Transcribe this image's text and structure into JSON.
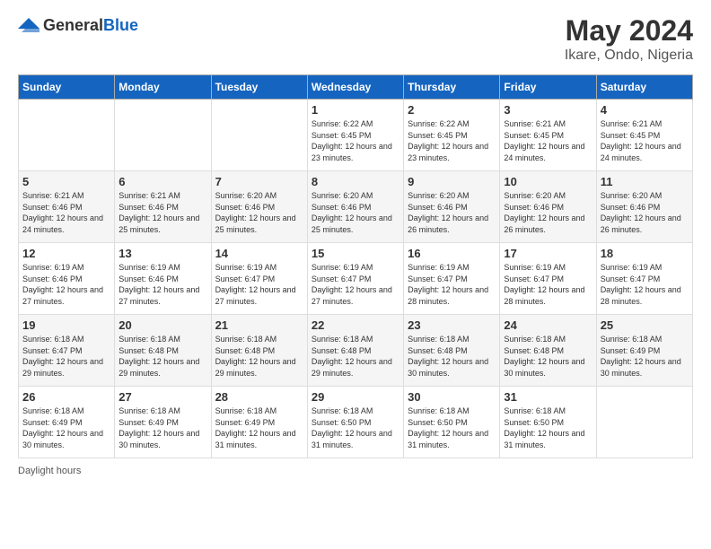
{
  "header": {
    "logo_general": "General",
    "logo_blue": "Blue",
    "main_title": "May 2024",
    "subtitle": "Ikare, Ondo, Nigeria"
  },
  "columns": [
    "Sunday",
    "Monday",
    "Tuesday",
    "Wednesday",
    "Thursday",
    "Friday",
    "Saturday"
  ],
  "footer": {
    "daylight_label": "Daylight hours"
  },
  "weeks": [
    [
      {
        "day": "",
        "sunrise": "",
        "sunset": "",
        "daylight": ""
      },
      {
        "day": "",
        "sunrise": "",
        "sunset": "",
        "daylight": ""
      },
      {
        "day": "",
        "sunrise": "",
        "sunset": "",
        "daylight": ""
      },
      {
        "day": "1",
        "sunrise": "Sunrise: 6:22 AM",
        "sunset": "Sunset: 6:45 PM",
        "daylight": "Daylight: 12 hours and 23 minutes."
      },
      {
        "day": "2",
        "sunrise": "Sunrise: 6:22 AM",
        "sunset": "Sunset: 6:45 PM",
        "daylight": "Daylight: 12 hours and 23 minutes."
      },
      {
        "day": "3",
        "sunrise": "Sunrise: 6:21 AM",
        "sunset": "Sunset: 6:45 PM",
        "daylight": "Daylight: 12 hours and 24 minutes."
      },
      {
        "day": "4",
        "sunrise": "Sunrise: 6:21 AM",
        "sunset": "Sunset: 6:45 PM",
        "daylight": "Daylight: 12 hours and 24 minutes."
      }
    ],
    [
      {
        "day": "5",
        "sunrise": "Sunrise: 6:21 AM",
        "sunset": "Sunset: 6:46 PM",
        "daylight": "Daylight: 12 hours and 24 minutes."
      },
      {
        "day": "6",
        "sunrise": "Sunrise: 6:21 AM",
        "sunset": "Sunset: 6:46 PM",
        "daylight": "Daylight: 12 hours and 25 minutes."
      },
      {
        "day": "7",
        "sunrise": "Sunrise: 6:20 AM",
        "sunset": "Sunset: 6:46 PM",
        "daylight": "Daylight: 12 hours and 25 minutes."
      },
      {
        "day": "8",
        "sunrise": "Sunrise: 6:20 AM",
        "sunset": "Sunset: 6:46 PM",
        "daylight": "Daylight: 12 hours and 25 minutes."
      },
      {
        "day": "9",
        "sunrise": "Sunrise: 6:20 AM",
        "sunset": "Sunset: 6:46 PM",
        "daylight": "Daylight: 12 hours and 26 minutes."
      },
      {
        "day": "10",
        "sunrise": "Sunrise: 6:20 AM",
        "sunset": "Sunset: 6:46 PM",
        "daylight": "Daylight: 12 hours and 26 minutes."
      },
      {
        "day": "11",
        "sunrise": "Sunrise: 6:20 AM",
        "sunset": "Sunset: 6:46 PM",
        "daylight": "Daylight: 12 hours and 26 minutes."
      }
    ],
    [
      {
        "day": "12",
        "sunrise": "Sunrise: 6:19 AM",
        "sunset": "Sunset: 6:46 PM",
        "daylight": "Daylight: 12 hours and 27 minutes."
      },
      {
        "day": "13",
        "sunrise": "Sunrise: 6:19 AM",
        "sunset": "Sunset: 6:46 PM",
        "daylight": "Daylight: 12 hours and 27 minutes."
      },
      {
        "day": "14",
        "sunrise": "Sunrise: 6:19 AM",
        "sunset": "Sunset: 6:47 PM",
        "daylight": "Daylight: 12 hours and 27 minutes."
      },
      {
        "day": "15",
        "sunrise": "Sunrise: 6:19 AM",
        "sunset": "Sunset: 6:47 PM",
        "daylight": "Daylight: 12 hours and 27 minutes."
      },
      {
        "day": "16",
        "sunrise": "Sunrise: 6:19 AM",
        "sunset": "Sunset: 6:47 PM",
        "daylight": "Daylight: 12 hours and 28 minutes."
      },
      {
        "day": "17",
        "sunrise": "Sunrise: 6:19 AM",
        "sunset": "Sunset: 6:47 PM",
        "daylight": "Daylight: 12 hours and 28 minutes."
      },
      {
        "day": "18",
        "sunrise": "Sunrise: 6:19 AM",
        "sunset": "Sunset: 6:47 PM",
        "daylight": "Daylight: 12 hours and 28 minutes."
      }
    ],
    [
      {
        "day": "19",
        "sunrise": "Sunrise: 6:18 AM",
        "sunset": "Sunset: 6:47 PM",
        "daylight": "Daylight: 12 hours and 29 minutes."
      },
      {
        "day": "20",
        "sunrise": "Sunrise: 6:18 AM",
        "sunset": "Sunset: 6:48 PM",
        "daylight": "Daylight: 12 hours and 29 minutes."
      },
      {
        "day": "21",
        "sunrise": "Sunrise: 6:18 AM",
        "sunset": "Sunset: 6:48 PM",
        "daylight": "Daylight: 12 hours and 29 minutes."
      },
      {
        "day": "22",
        "sunrise": "Sunrise: 6:18 AM",
        "sunset": "Sunset: 6:48 PM",
        "daylight": "Daylight: 12 hours and 29 minutes."
      },
      {
        "day": "23",
        "sunrise": "Sunrise: 6:18 AM",
        "sunset": "Sunset: 6:48 PM",
        "daylight": "Daylight: 12 hours and 30 minutes."
      },
      {
        "day": "24",
        "sunrise": "Sunrise: 6:18 AM",
        "sunset": "Sunset: 6:48 PM",
        "daylight": "Daylight: 12 hours and 30 minutes."
      },
      {
        "day": "25",
        "sunrise": "Sunrise: 6:18 AM",
        "sunset": "Sunset: 6:49 PM",
        "daylight": "Daylight: 12 hours and 30 minutes."
      }
    ],
    [
      {
        "day": "26",
        "sunrise": "Sunrise: 6:18 AM",
        "sunset": "Sunset: 6:49 PM",
        "daylight": "Daylight: 12 hours and 30 minutes."
      },
      {
        "day": "27",
        "sunrise": "Sunrise: 6:18 AM",
        "sunset": "Sunset: 6:49 PM",
        "daylight": "Daylight: 12 hours and 30 minutes."
      },
      {
        "day": "28",
        "sunrise": "Sunrise: 6:18 AM",
        "sunset": "Sunset: 6:49 PM",
        "daylight": "Daylight: 12 hours and 31 minutes."
      },
      {
        "day": "29",
        "sunrise": "Sunrise: 6:18 AM",
        "sunset": "Sunset: 6:50 PM",
        "daylight": "Daylight: 12 hours and 31 minutes."
      },
      {
        "day": "30",
        "sunrise": "Sunrise: 6:18 AM",
        "sunset": "Sunset: 6:50 PM",
        "daylight": "Daylight: 12 hours and 31 minutes."
      },
      {
        "day": "31",
        "sunrise": "Sunrise: 6:18 AM",
        "sunset": "Sunset: 6:50 PM",
        "daylight": "Daylight: 12 hours and 31 minutes."
      },
      {
        "day": "",
        "sunrise": "",
        "sunset": "",
        "daylight": ""
      }
    ]
  ]
}
